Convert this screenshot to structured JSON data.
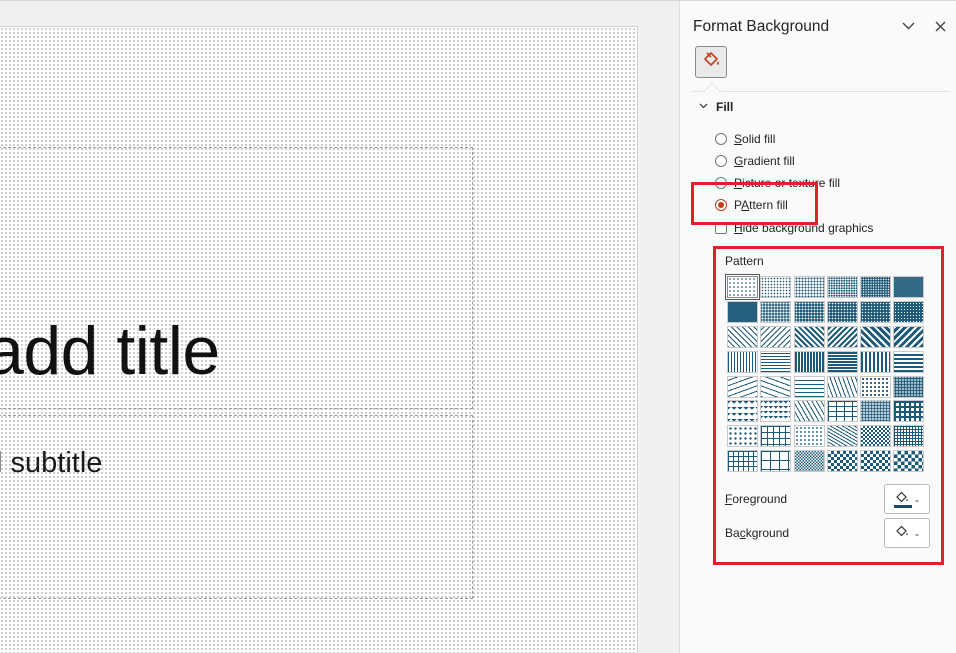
{
  "slide": {
    "title_text": "add title",
    "subtitle_text": "l subtitle"
  },
  "pane": {
    "title": "Format Background",
    "collapse_icon": "chevron-down-icon",
    "close_icon": "close-icon",
    "tab_icon": "paint-bucket-icon",
    "section": "Fill",
    "fill_options": [
      {
        "label": "Solid fill",
        "accel": "S",
        "rest": "olid fill",
        "selected": false
      },
      {
        "label": "Gradient fill",
        "accel": "G",
        "rest": "radient fill",
        "selected": false
      },
      {
        "label": "Picture or texture fill",
        "accel": "P",
        "rest": "icture or texture fill",
        "selected": false
      },
      {
        "label": "Pattern fill",
        "accel": "A",
        "pre": "P",
        "rest": "ttern fill",
        "selected": true
      }
    ],
    "hide_graphics": {
      "accel": "H",
      "rest": "ide background graphics",
      "checked": false
    },
    "pattern_label": "Pattern",
    "foreground": {
      "pre": "",
      "accel": "F",
      "rest": "oreground",
      "color": "#1a4a6b"
    },
    "background": {
      "pre": "Ba",
      "accel": "c",
      "rest": "kground",
      "color": "#ffffff"
    }
  },
  "colors": {
    "pattern_fg": "#1d5a7a",
    "highlight": "#e0202b",
    "accent": "#c43e1c"
  }
}
